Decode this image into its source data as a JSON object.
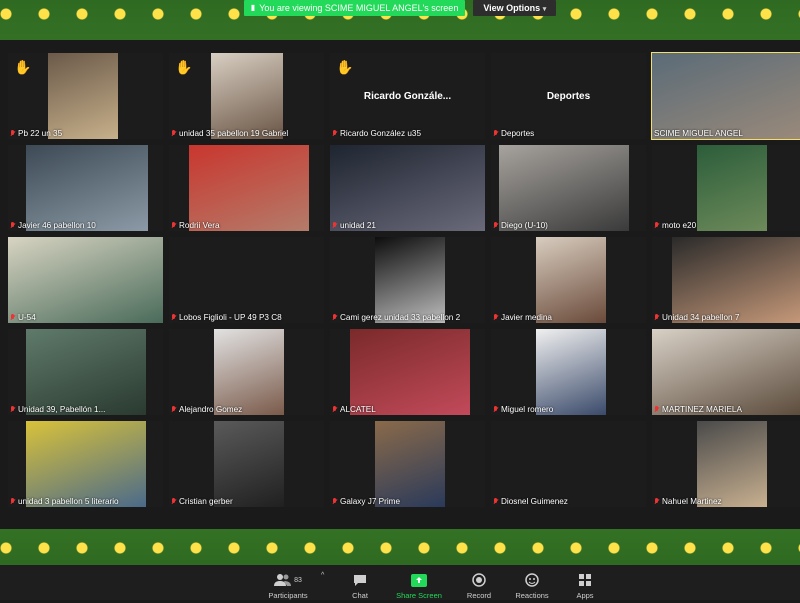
{
  "banner": {
    "text": "You are viewing SCIME MIGUEL ANGEL's screen",
    "view_options": "View Options"
  },
  "participants": [
    {
      "name": "Pb 22 un 35",
      "hand": true,
      "video": "#6b5a4a",
      "video2": "#c7b08a"
    },
    {
      "name": "unidad 35 pabellon 19 Gabriel",
      "hand": true,
      "video": "#d8cfc2",
      "video2": "#6a5545"
    },
    {
      "name": "Ricardo González u35",
      "hand": true,
      "display": "Ricardo Gonzále..."
    },
    {
      "name": "Deportes",
      "display": "Deportes"
    },
    {
      "name": "SCIME MIGUEL ANGEL",
      "video": "#5a6b78",
      "video2": "#9a8a7a",
      "active": true,
      "nomic": true
    },
    {
      "name": "Javier 46 pabellon 10",
      "video": "#3d4a55",
      "video2": "#8b9aa6"
    },
    {
      "name": "Rodrii Vera",
      "video": "#c9362e",
      "video2": "#b47c6a"
    },
    {
      "name": "unidad 21",
      "video": "#1e2430",
      "video2": "#6a6a7a"
    },
    {
      "name": "Diego (U-10)",
      "video": "#a7a39e",
      "video2": "#3a3a3a"
    },
    {
      "name": "moto e20",
      "video": "#2b5d3a",
      "video2": "#6d8a5a"
    },
    {
      "name": "U-54",
      "video": "#d8d4c2",
      "video2": "#4a6b5a"
    },
    {
      "name": "Lobos Figlioli  - UP 49 P3 C8"
    },
    {
      "name": "Cami gerez unidad 33 pabellon 2",
      "video": "#0d0d0d",
      "video2": "#bdbdbd"
    },
    {
      "name": "Javier medina",
      "video": "#d8cdbf",
      "video2": "#6a4a3a"
    },
    {
      "name": "Unidad 34 pabellon 7",
      "video": "#2a2a2a",
      "video2": "#c89a7a"
    },
    {
      "name": "Unidad 39, Pabellón 1...",
      "video": "#5f7a6a",
      "video2": "#2a3a30"
    },
    {
      "name": "Alejandro Gomez",
      "video": "#e2e2e2",
      "video2": "#7a5a4a"
    },
    {
      "name": "ALCATEL",
      "video": "#7a2a2a",
      "video2": "#c24a5a"
    },
    {
      "name": "Miguel romero",
      "video": "#f0f0f0",
      "video2": "#3a4a6a"
    },
    {
      "name": "MARTINEZ MARIELA",
      "video": "#d8d0c6",
      "video2": "#5a4a3a"
    },
    {
      "name": "unidad 3 pabellon 5 literario",
      "video": "#d9c23a",
      "video2": "#4a6a8a"
    },
    {
      "name": "Cristian gerber",
      "video": "#5a5a5a",
      "video2": "#202020"
    },
    {
      "name": "Galaxy J7 Prime",
      "video": "#8a6a4a",
      "video2": "#2a3a5a"
    },
    {
      "name": "Diosnel Guimenez"
    },
    {
      "name": "Nahuel Martinez",
      "video": "#4a4a4a",
      "video2": "#c8b090"
    }
  ],
  "toolbar": {
    "participants_label": "Participants",
    "participants_count": "83",
    "chat_label": "Chat",
    "share_label": "Share Screen",
    "record_label": "Record",
    "reactions_label": "Reactions",
    "apps_label": "Apps"
  }
}
